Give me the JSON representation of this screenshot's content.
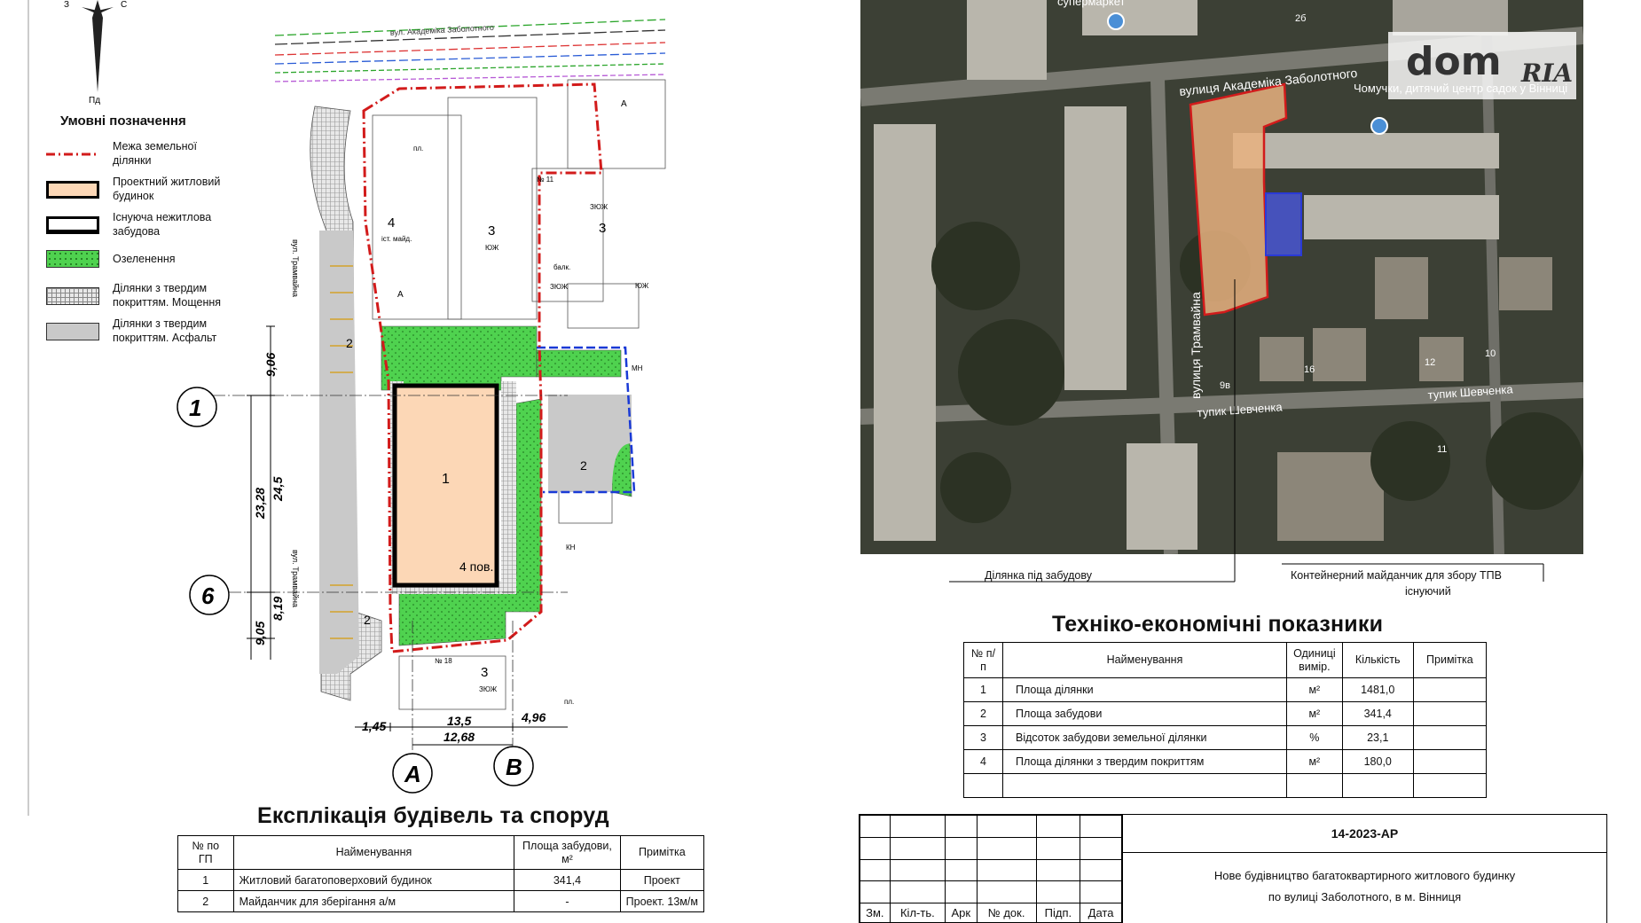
{
  "compass": {
    "w": "З",
    "e": "С",
    "s": "Пд"
  },
  "legend": {
    "title": "Умовні позначення",
    "items": [
      {
        "label": "Межа земельної ділянки",
        "icon": "boundary-line-icon"
      },
      {
        "label": "Проектний житловий будинок",
        "icon": "projected-building-icon"
      },
      {
        "label": "Існуюча нежитлова забудова",
        "icon": "existing-building-icon"
      },
      {
        "label": "Озеленення",
        "icon": "greenery-icon"
      },
      {
        "label": "Ділянки з твердим покриттям. Мощення",
        "icon": "paving-icon"
      },
      {
        "label": "Ділянки з твердим покриттям. Асфальт",
        "icon": "asphalt-icon"
      }
    ]
  },
  "plan": {
    "street_top": "вул. Академіка Заболотного",
    "street_side_upper": "вул. Трамвайна",
    "street_side_lower": "вул. Трамвайна",
    "zone_4": "4",
    "zone_4_sub": "іст. майд.",
    "zone_3a": "3",
    "zone_3a_sub": "ЮЖ",
    "zone_3b": "3",
    "zone_3b_sub": "ЗЮЖ",
    "zone_3c": "3",
    "zone_3c_sub": "ЗЮЖ",
    "zone_2a": "2",
    "zone_2b": "2",
    "zone_2c": "2",
    "building_num": "1",
    "building_floors": "4 пов.",
    "axis_1": "1",
    "axis_6": "6",
    "axis_a": "А",
    "axis_b": "В",
    "dim_906a": "9,06",
    "dim_245": "24,5",
    "dim_2328": "23,28",
    "dim_819": "8,19",
    "dim_905": "9,05",
    "dim_145": "1,45",
    "dim_135": "13,5",
    "dim_496": "4,96",
    "dim_1268": "12,68",
    "label_a": "А",
    "label_a2": "А",
    "label_mn": "МН",
    "label_no11": "№ 11",
    "label_no18": "№ 18",
    "label_kn": "КН",
    "label_zyuzh": "ЗЮЖ",
    "label_yuzh": "ЮЖ",
    "label_pl": "пл.",
    "label_pl2": "пл.",
    "label_balk": "балк."
  },
  "map": {
    "street_top": "вулиця Академіка Заболотного",
    "street_side": "вулиця Трамвайна",
    "street_bottom1": "тупик Шевченка",
    "street_bottom2": "тупик Шевченка",
    "poi_top": "супермаркет",
    "poi_kinder": "Чомучки, дитячий центр садок у Вінниці",
    "num_2b": "2б",
    "num_16": "16",
    "num_12": "12",
    "num_10": "10",
    "num_11": "11",
    "num_9v": "9в",
    "label_plot": "Ділянка під забудову",
    "label_container": "Контейнерний майданчик для збору ТПВ",
    "label_container_sub": "існуючий"
  },
  "logo": {
    "text_main": "dom",
    "text_sub": "RIA"
  },
  "teo": {
    "title": "Техніко-економічні показники",
    "headers": [
      "№ п/п",
      "Найменування",
      "Одиниці вимір.",
      "Кількість",
      "Примітка"
    ],
    "rows": [
      {
        "n": "1",
        "name": "Площа ділянки",
        "unit": "м²",
        "qty": "1481,0",
        "note": ""
      },
      {
        "n": "2",
        "name": "Площа забудови",
        "unit": "м²",
        "qty": "341,4",
        "note": ""
      },
      {
        "n": "3",
        "name": "Відсоток забудови земельної ділянки",
        "unit": "%",
        "qty": "23,1",
        "note": ""
      },
      {
        "n": "4",
        "name": "Площа ділянки з твердим покриттям",
        "unit": "м²",
        "qty": "180,0",
        "note": ""
      }
    ]
  },
  "explication": {
    "title": "Експлікація будівель та споруд",
    "headers": [
      "№ по ГП",
      "Найменування",
      "Площа забудови, м²",
      "Примітка"
    ],
    "rows": [
      {
        "n": "1",
        "name": "Житловий багатоповерховий будинок",
        "area": "341,4",
        "note": "Проект"
      },
      {
        "n": "2",
        "name": "Майданчик для зберігання а/м",
        "area": "-",
        "note": "Проект. 13м/м"
      }
    ]
  },
  "stamp": {
    "code": "14-2023-АР",
    "desc_line1": "Нове будівництво багатоквартирного житлового будинку",
    "desc_line2": "по вулиці Заболотного, в м. Вінниця",
    "cols": [
      "Зм.",
      "Кіл-ть.",
      "Арк",
      "№ док.",
      "Підп.",
      "Дата"
    ]
  }
}
